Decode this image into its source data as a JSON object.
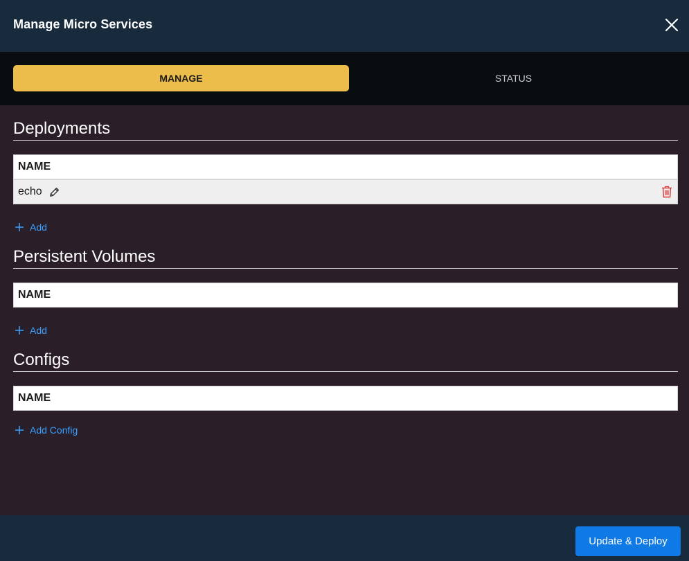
{
  "header": {
    "title": "Manage Micro Services",
    "close_icon": "close-icon"
  },
  "tabs": [
    {
      "label": "MANAGE",
      "active": true
    },
    {
      "label": "STATUS",
      "active": false
    }
  ],
  "colors": {
    "header_bg": "#172b3d",
    "tab_active": "#edbd4b",
    "body_bg": "#2a1f29",
    "link": "#3aa0ff",
    "primary_button": "#0f7ae5",
    "delete": "#d63a3a"
  },
  "deployments": {
    "title": "Deployments",
    "column": "NAME",
    "rows": [
      {
        "name": "echo"
      }
    ],
    "add_label": "Add"
  },
  "volumes": {
    "title": "Persistent Volumes",
    "column": "NAME",
    "add_label": "Add"
  },
  "configs": {
    "title": "Configs",
    "column": "NAME",
    "add_label": "Add Config"
  },
  "footer": {
    "deploy_label": "Update & Deploy"
  }
}
